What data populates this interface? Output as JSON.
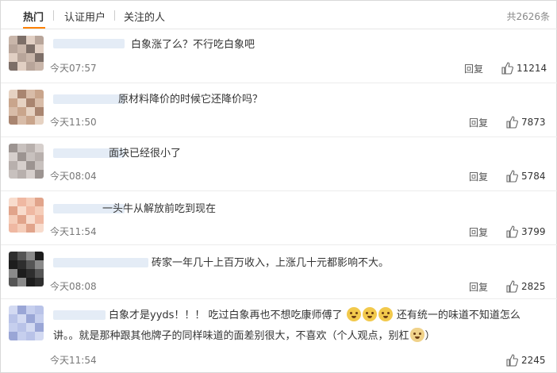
{
  "tabs": {
    "items": [
      "热门",
      "认证用户",
      "关注的人"
    ],
    "total": "共2626条"
  },
  "reply_label": "回复",
  "comments": [
    {
      "text": "白象涨了么？不行吃白象吧",
      "time": "今天07:57",
      "likes": "11214",
      "avatar_colors": [
        "#c9b6aa",
        "#7d6f68",
        "#e1cfc3",
        "#b8a59a"
      ]
    },
    {
      "text": "原材料降价的时候它还降价吗？",
      "time": "今天11:50",
      "likes": "7873",
      "avatar_colors": [
        "#c9a58c",
        "#e6d2c2",
        "#a98570",
        "#d8bca8"
      ]
    },
    {
      "text": "面块已经很小了",
      "time": "今天08:04",
      "likes": "5784",
      "avatar_colors": [
        "#b8b0ad",
        "#d6cfcc",
        "#9c9491",
        "#c8c1be"
      ]
    },
    {
      "text": "一头牛从解放前吃到现在",
      "time": "今天11:54",
      "likes": "3799",
      "avatar_colors": [
        "#efb8a2",
        "#f5cdb9",
        "#e1a48b",
        "#f8dccd"
      ]
    },
    {
      "text": "砖家一年几十上百万收入，上涨几十元都影响不大。",
      "time": "今天08:08",
      "likes": "2825",
      "avatar_colors": [
        "#2e2e2e",
        "#555555",
        "#8a8a8a",
        "#1d1d1d"
      ]
    },
    {
      "text_parts": [
        "白象才是yyds！！！ 吃过白象再也不想吃康师傅了",
        "还有统一的味道不知道怎么",
        "讲。。就是那种跟其他牌子的同样味道的面差别很大，不喜欢（个人观点，别杠",
        "）"
      ],
      "time": "今天11:54",
      "likes": "2245",
      "avatar_colors": [
        "#b9c3e8",
        "#d3daf2",
        "#9aa6d6",
        "#c6cfee"
      ]
    }
  ],
  "colors": {
    "accent": "#ff8200",
    "username_placeholder": "#e4ecf6"
  }
}
